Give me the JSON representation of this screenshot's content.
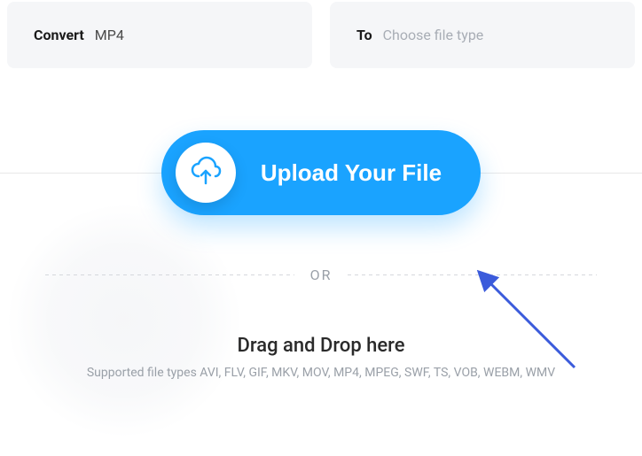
{
  "convert": {
    "label": "Convert",
    "value": "MP4"
  },
  "to": {
    "label": "To",
    "placeholder": "Choose file type"
  },
  "upload": {
    "button_label": "Upload Your File",
    "or": "OR",
    "drag_label": "Drag and Drop here",
    "supported": "Supported file types AVI, FLV, GIF, MKV, MOV, MP4, MPEG, SWF, TS, VOB, WEBM, WMV"
  }
}
